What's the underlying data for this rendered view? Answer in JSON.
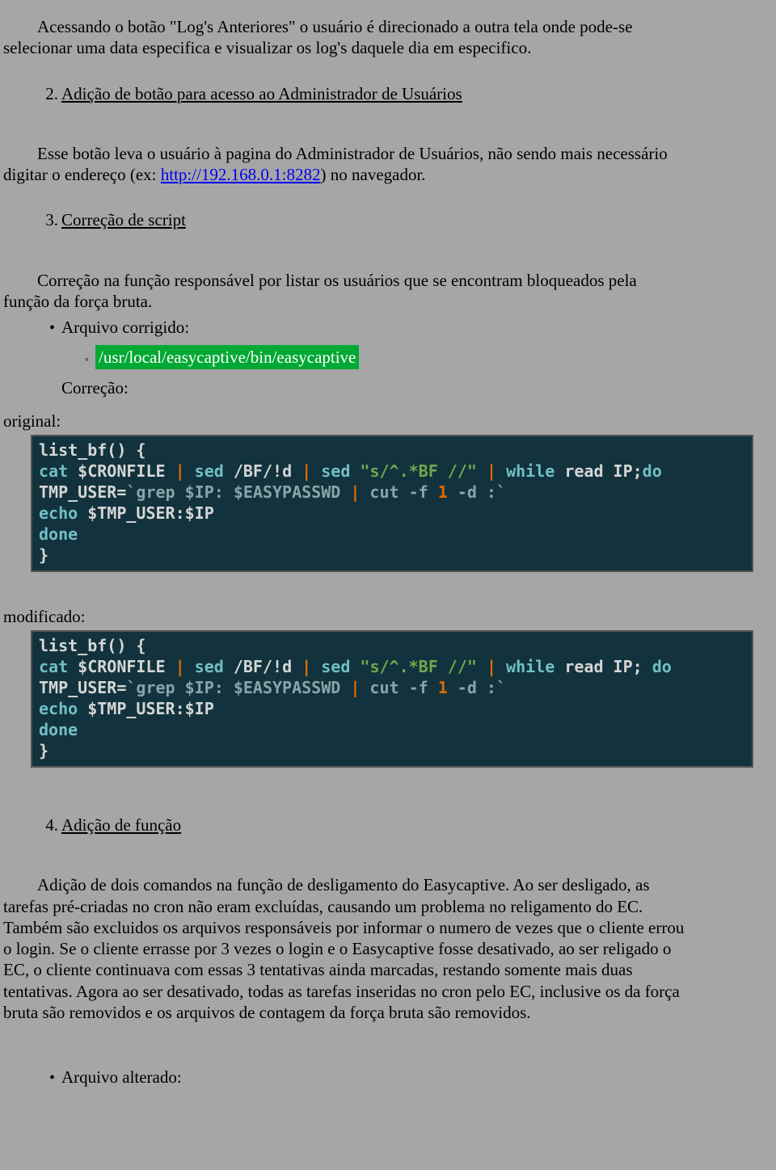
{
  "p1a": "Acessando o botão \"Log's Anteriores\" o usuário é direcionado a outra tela onde pode-se",
  "p1b": "selecionar uma data especifica e visualizar os log's daquele dia em especifico.",
  "item2_num": "2.",
  "item2_title": "Adição de botão para acesso ao Administrador de Usuários",
  "p2a_lead": "Esse botão leva o usuário à pagina do Administrador de Usuários, não sendo mais necessário",
  "p2b_before": "digitar o endereço (ex: ",
  "p2b_link": "http://192.168.0.1:8282",
  "p2b_after": ") no navegador.",
  "item3_num": "3.",
  "item3_title": "Correção de script",
  "p3a_lead": "Correção na função responsável por listar os usuários que se encontram bloqueados pela",
  "p3b": "função da força bruta.",
  "bullet_mark": "•",
  "sub_mark": "◦",
  "arquivo_corrigido": "Arquivo corrigido:",
  "hl_path": "/usr/local/easycaptive/bin/easycaptive",
  "correcao_label": "Correção:",
  "original_label": "original:",
  "modificado_label": "modificado:",
  "code_original": {
    "l1_a": "list_bf",
    "l1_b": "() {",
    "l2_a": "cat",
    "l2_b": " $CRONFILE ",
    "l2_c": "|",
    "l2_d": " sed ",
    "l2_e": "/BF/!",
    "l2_f": "d ",
    "l2_g": "|",
    "l2_h": " sed ",
    "l2_i": "\"s/^.*BF //\"",
    "l2_j": " ",
    "l2_k": "|",
    "l2_l": " ",
    "l2_m": "while",
    "l2_n": " read IP;",
    "l2_o": "do",
    "l3_a": "TMP_USER=",
    "l3_b": "`",
    "l3_c": "grep $IP: $EASYPASSWD ",
    "l3_d": "|",
    "l3_e": " cut -f ",
    "l3_f": "1",
    "l3_g": " -d :",
    "l3_h": "`",
    "l4_a": "echo",
    "l4_b": " $TMP_USER:$IP",
    "l5": "done",
    "l6": "}"
  },
  "code_modified": {
    "l1_a": "list_bf",
    "l1_b": "() {",
    "l2_a": "cat",
    "l2_b": " $CRONFILE ",
    "l2_c": "|",
    "l2_d": " sed ",
    "l2_e": "/BF/!",
    "l2_f": "d ",
    "l2_g": "|",
    "l2_h": " sed ",
    "l2_i": "\"s/^.*BF //\"",
    "l2_j": " ",
    "l2_k": "|",
    "l2_l": " ",
    "l2_m": "while",
    "l2_n": " read IP; ",
    "l2_o": "do",
    "l3_a": "TMP_USER=",
    "l3_b": "`",
    "l3_c": "grep $IP: $EASYPASSWD ",
    "l3_d": "|",
    "l3_e": " cut -f ",
    "l3_f": "1",
    "l3_g": " -d :",
    "l3_h": "`",
    "l4_a": "echo",
    "l4_b": " $TMP_USER:$IP",
    "l5": "done",
    "l6": "}"
  },
  "item4_num": "4.",
  "item4_title": "Adição de função",
  "p4a_lead": "Adição de dois comandos na função de desligamento do Easycaptive. Ao ser desligado, as",
  "p4b": "tarefas pré-criadas no cron não eram excluídas, causando um problema no religamento do EC.",
  "p4c": "Também são excluidos os arquivos responsáveis por informar o numero de vezes que o cliente errou",
  "p4d": "o login. Se o cliente errasse por 3 vezes o login e o Easycaptive fosse desativado, ao ser religado o",
  "p4e": "EC, o cliente continuava com essas 3 tentativas ainda marcadas, restando somente mais duas",
  "p4f": "tentativas. Agora ao ser desativado, todas as tarefas inseridas no cron pelo EC, inclusive os da força",
  "p4g": "bruta são removidos e os arquivos de contagem da força bruta são removidos.",
  "arquivo_alterado": "Arquivo alterado:"
}
